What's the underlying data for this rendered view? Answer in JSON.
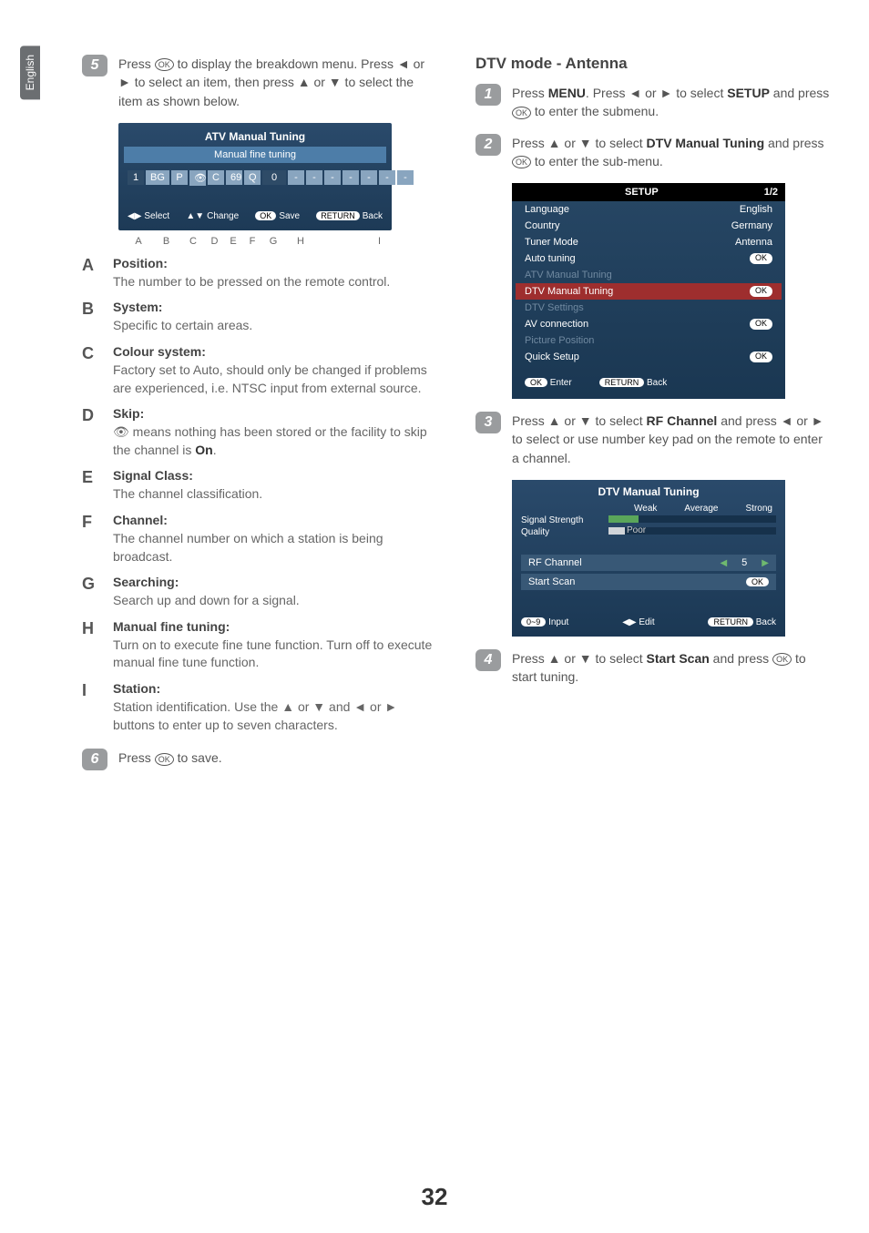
{
  "tab": "English",
  "left": {
    "step5": {
      "num": "5",
      "text_a": "Press ",
      "text_b": " to display the breakdown menu. Press ◄ or ► to select an item, then press ▲ or ▼ to select the item as shown below."
    },
    "atv": {
      "title": "ATV Manual Tuning",
      "sub": "Manual fine tuning",
      "segs": [
        "1",
        "BG",
        "P",
        "👁",
        "C",
        "69",
        "Q",
        "0",
        "-",
        "-",
        "-",
        "-",
        "-",
        "-",
        "-"
      ],
      "footer": {
        "select": "Select",
        "change": "Change",
        "save": "Save",
        "back": "Back",
        "ok": "OK",
        "return": "RETURN"
      },
      "pointers": [
        "A",
        "B",
        "C",
        "D",
        "E",
        "F",
        "G",
        "H",
        "I"
      ]
    },
    "items": {
      "A": {
        "t": "Position:",
        "d": "The number to be pressed on the remote control."
      },
      "B": {
        "t": "System:",
        "d": "Specific to certain areas."
      },
      "C": {
        "t": "Colour system:",
        "d": "Factory set to Auto, should only be changed if problems are experienced, i.e. NTSC input from external source."
      },
      "D": {
        "t": "Skip:",
        "d_pre": "",
        "d_post": " means nothing has been stored or the facility to skip the channel is ",
        "d_bold": "On",
        "d_end": "."
      },
      "E": {
        "t": "Signal Class:",
        "d": "The channel classification."
      },
      "F": {
        "t": "Channel:",
        "d": "The channel number on which a station is being broadcast."
      },
      "G": {
        "t": "Searching:",
        "d": "Search up and down for a signal."
      },
      "H": {
        "t": "Manual fine tuning:",
        "d": "Turn on to execute fine tune function. Turn off to execute manual fine tune function."
      },
      "I": {
        "t": "Station:",
        "d": "Station identification. Use the ▲ or ▼ and ◄ or ► buttons to enter up to seven characters."
      }
    },
    "step6": {
      "num": "6",
      "text_a": "Press ",
      "text_b": " to save."
    }
  },
  "right": {
    "heading": "DTV mode - Antenna",
    "step1": {
      "num": "1",
      "a": "Press ",
      "menu": "MENU",
      "b": ". Press ◄ or ► to select ",
      "setup": "SETUP",
      "c": " and press ",
      "d": " to enter  the submenu."
    },
    "step2": {
      "num": "2",
      "a": "Press ▲ or ▼ to select ",
      "bold": "DTV Manual Tuning",
      "b": " and press ",
      "c": " to enter the sub-menu."
    },
    "setup": {
      "title": "SETUP",
      "page": "1/2",
      "rows": [
        {
          "l": "Language",
          "r": "English"
        },
        {
          "l": "Country",
          "r": "Germany"
        },
        {
          "l": "Tuner Mode",
          "r": "Antenna"
        },
        {
          "l": "Auto tuning",
          "r": "OK",
          "chip": true
        },
        {
          "l": "ATV Manual Tuning",
          "dim": true
        },
        {
          "l": "DTV Manual Tuning",
          "r": "OK",
          "chip": true,
          "hl": true
        },
        {
          "l": "DTV Settings",
          "dim": true
        },
        {
          "l": "AV connection",
          "r": "OK",
          "chip": true
        },
        {
          "l": "Picture Position",
          "dim": true
        },
        {
          "l": "Quick Setup",
          "r": "OK",
          "chip": true
        }
      ],
      "foot": {
        "ok": "OK",
        "enter": "Enter",
        "return": "RETURN",
        "back": "Back"
      }
    },
    "step3": {
      "num": "3",
      "a": "Press ▲ or ▼ to select ",
      "bold": "RF Channel",
      "b": " and press ◄ or ► to select or use number key pad on the remote to enter a channel."
    },
    "dtv": {
      "title": "DTV Manual Tuning",
      "meter": {
        "weak": "Weak",
        "avg": "Average",
        "strong": "Strong"
      },
      "sig": "Signal Strength",
      "qual": "Quality",
      "poor": "Poor",
      "rf": {
        "l": "RF Channel",
        "v": "5"
      },
      "scan": {
        "l": "Start Scan",
        "v": "OK"
      },
      "foot": {
        "numchip": "0~9",
        "input": "Input",
        "edit": "Edit",
        "return": "RETURN",
        "back": "Back"
      }
    },
    "step4": {
      "num": "4",
      "a": "Press ▲ or ▼ to select ",
      "bold": "Start Scan",
      "b": " and press ",
      "c": " to start tuning."
    }
  },
  "page": "32",
  "ok_glyph": "OK"
}
